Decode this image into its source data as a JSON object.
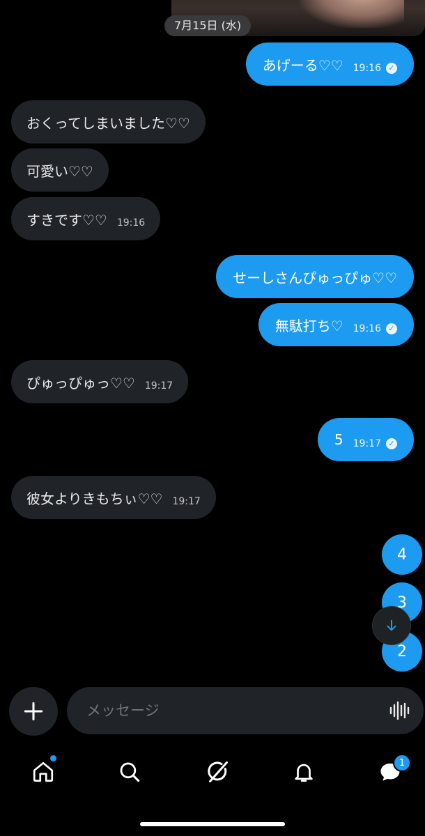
{
  "date_separator": "7月15日 (水)",
  "messages": [
    {
      "text": "あげーる♡♡",
      "time": "19:16"
    },
    {
      "text": "おくってしまいました♡♡"
    },
    {
      "text": "可愛い♡♡"
    },
    {
      "text": "すきです♡♡",
      "time": "19:16"
    },
    {
      "text": "せーしさんぴゅっぴゅ♡♡"
    },
    {
      "text": "無駄打ち♡",
      "time": "19:16"
    },
    {
      "text": "ぴゅっぴゅっ♡♡",
      "time": "19:17"
    },
    {
      "text": "5",
      "time": "19:17"
    },
    {
      "text": "彼女よりきもちぃ♡♡",
      "time": "19:17"
    }
  ],
  "count_bubbles": [
    "4",
    "3",
    "2"
  ],
  "composer": {
    "placeholder": "メッセージ"
  },
  "nav": {
    "messages_badge": "1"
  },
  "colors": {
    "accent": "#1d9bf0",
    "incoming_bubble": "#202327",
    "background": "#000000"
  },
  "icons": [
    "check-icon",
    "arrow-down-icon",
    "plus-icon",
    "waveform-icon",
    "home-icon",
    "search-icon",
    "grok-icon",
    "bell-icon",
    "messages-icon"
  ]
}
